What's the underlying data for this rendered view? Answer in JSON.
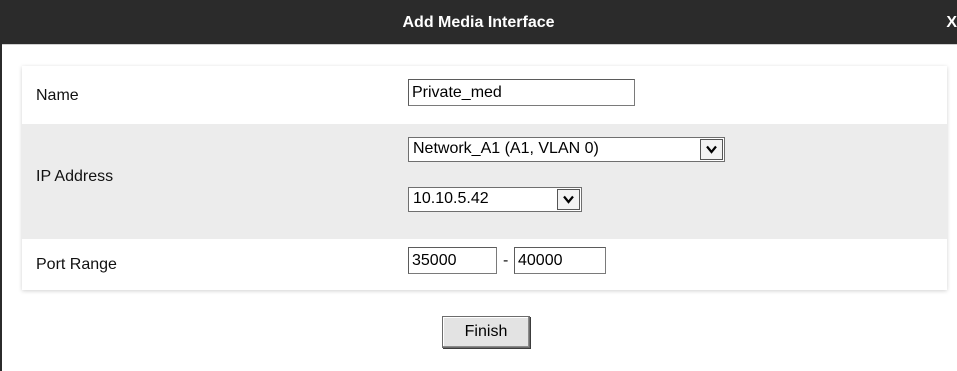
{
  "dialog": {
    "title": "Add Media Interface",
    "close_label": "X"
  },
  "form": {
    "name": {
      "label": "Name",
      "value": "Private_med"
    },
    "ip_address": {
      "label": "IP Address",
      "network_selected": "Network_A1 (A1, VLAN 0)",
      "ip_selected": "10.10.5.42"
    },
    "port_range": {
      "label": "Port Range",
      "start": "35000",
      "separator": "-",
      "end": "40000"
    }
  },
  "actions": {
    "finish_label": "Finish"
  },
  "icons": {
    "dropdown": "chevron-down-icon"
  }
}
